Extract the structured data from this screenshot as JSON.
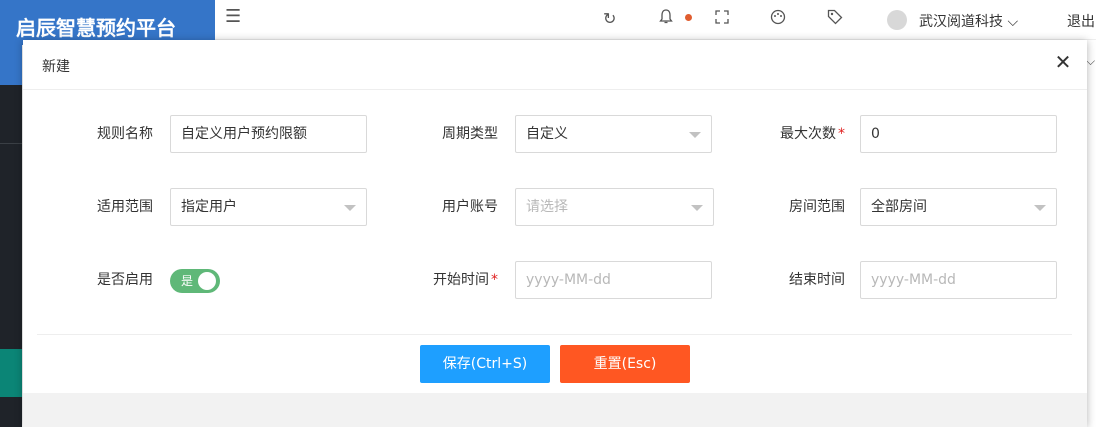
{
  "app": {
    "logo_text": "启辰智慧预约平台",
    "user_name": "武汉阅道科技",
    "logout_label": "退出"
  },
  "header_icons": [
    "menu-fold-icon",
    "refresh-icon",
    "bell-icon",
    "fullscreen-icon",
    "theme-icon",
    "tag-icon"
  ],
  "dialog": {
    "title": "新建",
    "close_glyph": "✕",
    "form": {
      "rule_name": {
        "label": "规则名称",
        "value": "自定义用户预约限额"
      },
      "period_type": {
        "label": "周期类型",
        "value": "自定义"
      },
      "max_times": {
        "label": "最大次数",
        "required_mark": "*",
        "value": "0"
      },
      "scope": {
        "label": "适用范围",
        "value": "指定用户"
      },
      "user_account": {
        "label": "用户账号",
        "placeholder": "请选择"
      },
      "room_scope": {
        "label": "房间范围",
        "value": "全部房间"
      },
      "enabled": {
        "label": "是否启用",
        "value_text": "是",
        "on": true
      },
      "start_time": {
        "label": "开始时间",
        "required_mark": "*",
        "placeholder": "yyyy-MM-dd"
      },
      "end_time": {
        "label": "结束时间",
        "placeholder": "yyyy-MM-dd"
      }
    },
    "buttons": {
      "save": "保存(Ctrl+S)",
      "reset": "重置(Esc)"
    }
  },
  "colors": {
    "primary": "#1e9fff",
    "danger": "#ff5722",
    "toggle_on": "#5fb878",
    "required": "#e02020",
    "logo_bg": "#3575c8"
  }
}
